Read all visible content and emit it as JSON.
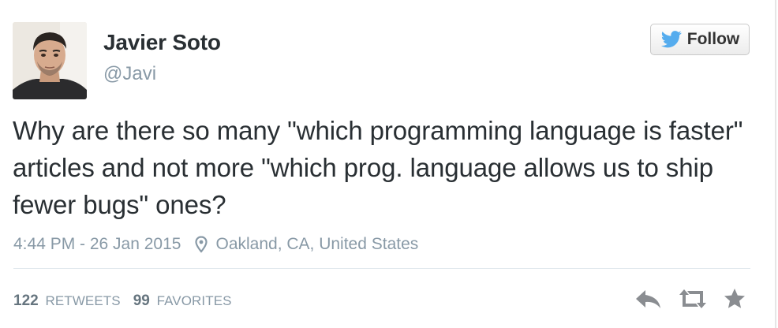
{
  "tweet": {
    "author_name": "Javier Soto",
    "author_handle": "@Javi",
    "follow_label": "Follow",
    "text": "Why are there so many \"which programming language is faster\" articles and not more \"which prog. language allows us to ship fewer bugs\" ones?",
    "timestamp": "4:44 PM - 26 Jan 2015",
    "location": "Oakland, CA, United States",
    "retweet_count": "122",
    "retweet_label": "RETWEETS",
    "favorite_count": "99",
    "favorite_label": "FAVORITES"
  },
  "icons": {
    "follow": "twitter-bird-icon",
    "location": "location-pin-icon",
    "reply": "reply-icon",
    "retweet": "retweet-icon",
    "favorite": "star-icon"
  },
  "colors": {
    "twitter_blue": "#55acee",
    "text": "#292f33",
    "muted": "#8899a6",
    "action_gray": "#8a8d91"
  }
}
